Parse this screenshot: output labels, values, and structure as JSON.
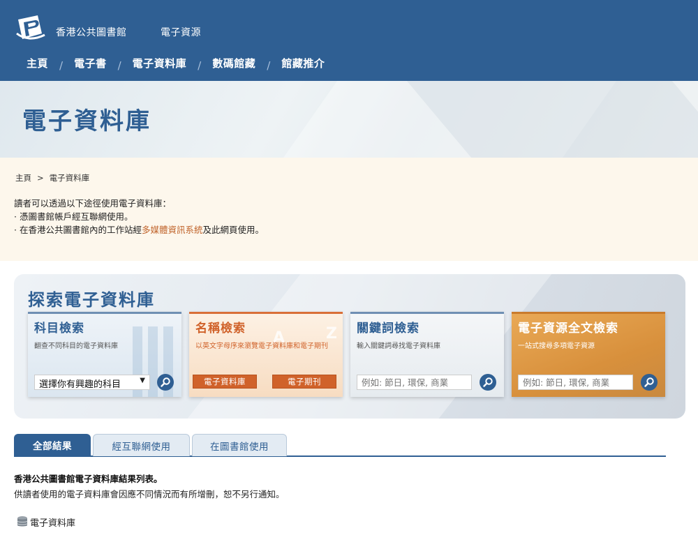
{
  "header": {
    "brand": "香港公共圖書館",
    "section": "電子資源",
    "nav": [
      "主頁",
      "電子書",
      "電子資料庫",
      "數碼館藏",
      "館藏推介"
    ],
    "nav_separator": "/"
  },
  "hero": {
    "title": "電子資料庫"
  },
  "breadcrumb": {
    "home": "主頁",
    "separator": ">",
    "current": "電子資料庫"
  },
  "info": {
    "intro": "讀者可以透過以下途徑使用電子資料庫：",
    "item1": "· 憑圖書館帳戶經互聯網使用。",
    "item2_prefix": "· 在香港公共圖書館內的工作站經",
    "item2_link": "多媒體資訊系統",
    "item2_suffix": "及此網頁使用。"
  },
  "explore": {
    "title": "探索電子資料庫",
    "subject": {
      "title": "科目檢索",
      "desc": "翻查不同科目的電子資料庫",
      "select_value": "選擇你有興趣的科目"
    },
    "name": {
      "title": "名稱檢索",
      "desc": "以英文字母序來瀏覽電子資料庫和電子期刊",
      "btn_db": "電子資料庫",
      "btn_journal": "電子期刊",
      "deco_letters": [
        "A",
        "Z"
      ]
    },
    "keyword": {
      "title": "關鍵詞檢索",
      "desc": "輸入關鍵詞尋找電子資料庫",
      "placeholder": "例如: 節日, 環保, 商業"
    },
    "fulltext": {
      "title": "電子資源全文檢索",
      "desc": "一站式搜尋多項電子資源",
      "placeholder": "例如: 節日, 環保, 商業"
    }
  },
  "tabs": [
    "全部結果",
    "經互聯網使用",
    "在圖書館使用"
  ],
  "results": {
    "title": "香港公共圖書館電子資料庫結果列表。",
    "note": "供讀者使用的電子資料庫會因應不同情況而有所增刪，恕不另行通知。",
    "section_label": "電子資料庫"
  },
  "colors": {
    "primary": "#2f5f93",
    "accent_orange": "#d0622a",
    "fulltext_gold": "#d8903c",
    "info_bg": "#fdf7ec"
  }
}
